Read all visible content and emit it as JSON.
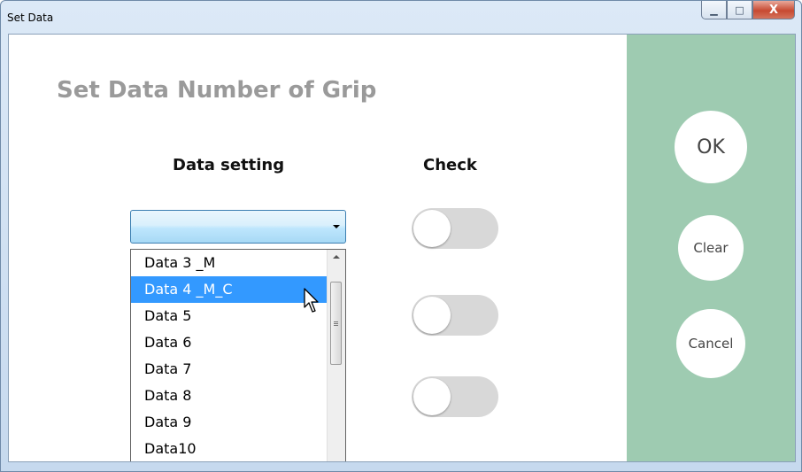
{
  "window": {
    "title": "Set Data",
    "controls": {
      "minimize_icon": "minimize-icon",
      "maximize_icon": "maximize-icon",
      "close_label": "X"
    }
  },
  "main": {
    "heading": "Set Data Number of Grip",
    "data_setting_label": "Data setting",
    "check_label": "Check",
    "combo_value": "",
    "dropdown": {
      "items": [
        "Data 3 _M",
        "Data 4 _M_C",
        "Data 5",
        "Data 6",
        "Data 7",
        "Data 8",
        "Data 9",
        "Data10"
      ],
      "selected_index": 1,
      "selected_color": "#3399ff"
    },
    "toggles": [
      {
        "state": "off"
      },
      {
        "state": "off"
      },
      {
        "state": "off"
      }
    ]
  },
  "side_panel": {
    "background": "#9ecbb1",
    "ok_label": "OK",
    "clear_label": "Clear",
    "cancel_label": "Cancel"
  }
}
